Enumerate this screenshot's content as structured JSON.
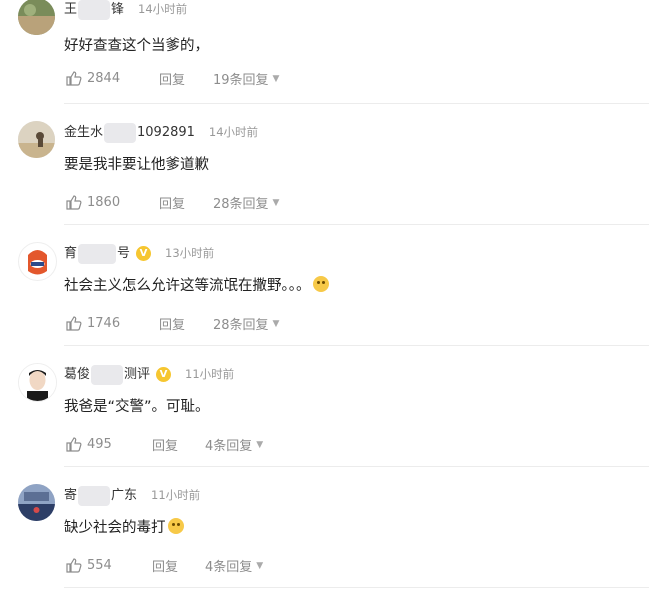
{
  "comments": [
    {
      "name_prefix": "王",
      "name_suffix": "锋",
      "verified": false,
      "time": "14小时前",
      "text": "好好查查这个当爹的，",
      "emoji": false,
      "likes": "2844",
      "reply_label": "回复",
      "replies": "19条回复",
      "avatar_colors": [
        "#7a8c5a",
        "#b9a27a"
      ]
    },
    {
      "name_prefix": "金生水",
      "name_suffix": "1092891",
      "verified": false,
      "time": "14小时前",
      "text": "要是我非要让他爹道歉",
      "emoji": false,
      "likes": "1860",
      "reply_label": "回复",
      "replies": "28条回复",
      "avatar_colors": [
        "#c9b48e",
        "#5a4a38"
      ]
    },
    {
      "name_prefix": "育",
      "name_suffix": "号",
      "verified": true,
      "verified_symbol": "V",
      "time": "13小时前",
      "text": "社会主义怎么允许这等流氓在撒野。。。",
      "emoji": true,
      "likes": "1746",
      "reply_label": "回复",
      "replies": "28条回复",
      "avatar_colors": [
        "#e3572c",
        "#ffffff"
      ]
    },
    {
      "name_prefix": "葛俊",
      "name_suffix": "测评",
      "verified": true,
      "verified_symbol": "V",
      "time": "11小时前",
      "text": "我爸是“交警”。可耻。",
      "emoji": false,
      "likes": "495",
      "reply_label": "回复",
      "replies": "4条回复",
      "avatar_colors": [
        "#f1d8c4",
        "#1a1a1a"
      ]
    },
    {
      "name_prefix": "寄",
      "name_suffix": "广东",
      "verified": false,
      "time": "11小时前",
      "text": "缺少社会的毒打",
      "emoji": true,
      "likes": "554",
      "reply_label": "回复",
      "replies": "4条回复",
      "avatar_colors": [
        "#2d3e66",
        "#8fa3c4"
      ]
    }
  ],
  "icons": {
    "like": "thumbs-up-icon",
    "expand": "chevron-down-icon",
    "verified": "verified-badge-icon",
    "emoji": "laughing-emoji-icon"
  },
  "colors": {
    "verified_badge": "#f6c630",
    "muted_text": "#999999",
    "action_text": "#8d8d8d"
  }
}
